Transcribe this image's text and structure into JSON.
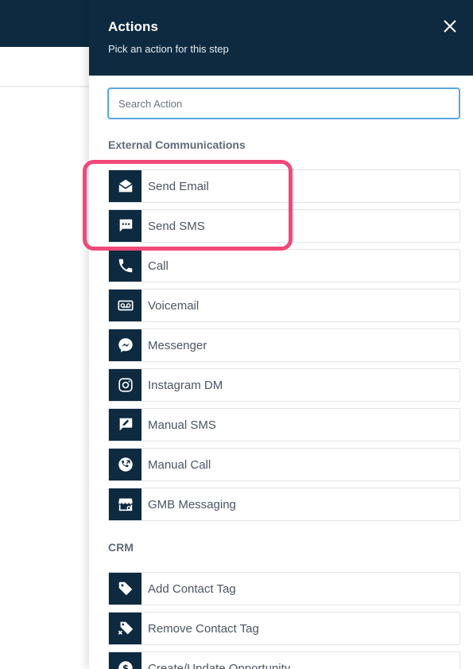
{
  "panel": {
    "title": "Actions",
    "subtitle": "Pick an action for this step",
    "close_icon": "close-icon"
  },
  "search": {
    "placeholder": "Search Action",
    "value": ""
  },
  "sections": [
    {
      "heading": "External Communications",
      "items": [
        {
          "label": "Send Email",
          "icon": "email-open-icon"
        },
        {
          "label": "Send SMS",
          "icon": "sms-bubble-icon"
        },
        {
          "label": "Call",
          "icon": "phone-icon"
        },
        {
          "label": "Voicemail",
          "icon": "voicemail-icon"
        },
        {
          "label": "Messenger",
          "icon": "messenger-icon"
        },
        {
          "label": "Instagram DM",
          "icon": "instagram-icon"
        },
        {
          "label": "Manual SMS",
          "icon": "edit-message-icon"
        },
        {
          "label": "Manual Call",
          "icon": "phone-callback-icon"
        },
        {
          "label": "GMB Messaging",
          "icon": "storefront-icon"
        }
      ]
    },
    {
      "heading": "CRM",
      "items": [
        {
          "label": "Add Contact Tag",
          "icon": "tag-icon"
        },
        {
          "label": "Remove Contact Tag",
          "icon": "tag-remove-icon"
        },
        {
          "label": "Create/Update Opportunity",
          "icon": "dollar-icon"
        }
      ]
    }
  ],
  "colors": {
    "header_bg": "#0e2a40",
    "icon_bg": "#0e2a40",
    "search_border": "#5aa7e0",
    "highlight": "#f1487a",
    "label_text": "#4a5563",
    "heading_text": "#5f6b7a"
  }
}
